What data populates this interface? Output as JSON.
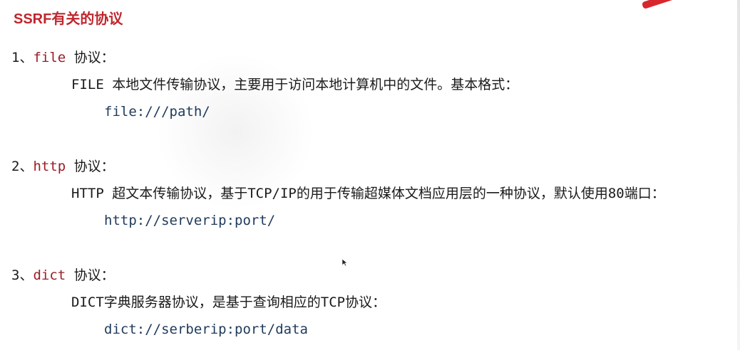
{
  "slide": {
    "title": "SSRF有关的协议"
  },
  "protocols": [
    {
      "number": "1、",
      "name": "file",
      "suffix": " 协议：",
      "description": "FILE 本地文件传输协议，主要用于访问本地计算机中的文件。基本格式：",
      "url": "file:///path/"
    },
    {
      "number": "2、",
      "name": "http",
      "suffix": " 协议：",
      "description": "HTTP 超文本传输协议，基于TCP/IP的用于传输超媒体文档应用层的一种协议，默认使用80端口：",
      "url": "http://serverip:port/"
    },
    {
      "number": "3、",
      "name": "dict",
      "suffix": " 协议：",
      "description": "DICT字典服务器协议，是基于查询相应的TCP协议：",
      "url": "dict://serberip:port/data"
    }
  ],
  "colors": {
    "title": "#c0262d",
    "protocol_name": "#9b1d24",
    "url": "#1f3a5a",
    "accent": "#d8262e"
  },
  "icons": {
    "cursor": "mouse-pointer-icon"
  }
}
